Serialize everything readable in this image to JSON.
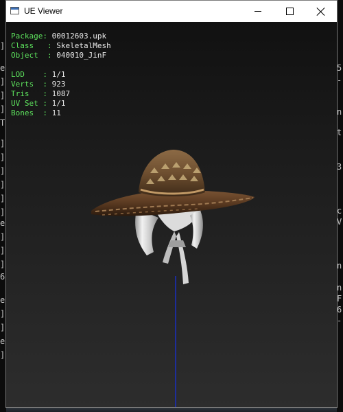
{
  "window": {
    "title": "UE Viewer"
  },
  "info_panel": {
    "rows": [
      {
        "label": "Package: ",
        "value": "00012603.upk"
      },
      {
        "label": "Class   : ",
        "value": "SkeletalMesh"
      },
      {
        "label": "Object  : ",
        "value": "040010_JinF"
      }
    ],
    "stats": [
      {
        "label": "LOD    : ",
        "value": "1/1"
      },
      {
        "label": "Verts  : ",
        "value": "923"
      },
      {
        "label": "Tris   : ",
        "value": "1087"
      },
      {
        "label": "UV Set : ",
        "value": "1/1"
      },
      {
        "label": "Bones  : ",
        "value": "11"
      }
    ]
  },
  "background_console": {
    "left_chars": [
      "]",
      "e",
      "]",
      "]",
      "]",
      "T",
      "]",
      "]",
      "]",
      "]",
      "]",
      "]",
      "e",
      "]",
      "]",
      "]",
      "6",
      "e",
      "]",
      "]",
      "e",
      "]"
    ],
    "right_chars": [
      "5",
      "-",
      "n",
      "t",
      "3",
      "c",
      "V",
      "n",
      "n",
      "F",
      "6",
      "-"
    ]
  },
  "colors": {
    "info_label": "#5ee45e",
    "info_value": "#e8e8e8",
    "axis_line": "#1a2fbf",
    "viewport_top": "#111111",
    "viewport_bottom": "#2d2d2d"
  }
}
